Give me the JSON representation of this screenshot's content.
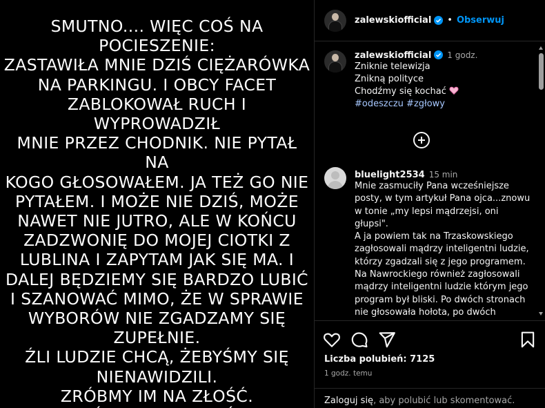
{
  "post_image": {
    "text": "SMUTNO....    WIĘC COŚ NA\nPOCIESZENIE:\nZASTAWIŁA MNIE DZIŚ CIĘŻARÓWKA\nNA PARKINGU. I OBCY FACET\nZABLOKOWAŁ RUCH I WYPROWADZIŁ\nMNIE PRZEZ CHODNIK. NIE PYTAŁ NA\nKOGO GŁOSOWAŁEM. JA TEŻ GO NIE\nPYTAŁEM. I MOŻE NIE DZIŚ, MOŻE\nNAWET NIE JUTRO, ALE W KOŃCU\nZADZWONIĘ DO MOJEJ CIOTKI Z\nLUBLINA I ZAPYTAM JAK SIĘ MA. I\nDALEJ BĘDZIEMY SIĘ BARDZO LUBIĆ\nI SZANOWAĆ MIMO, ŻE W SPRAWIE\nWYBORÓW NIE ZGADZAMY SIĘ\nZUPEŁNIE.\nŹLI LUDZIE CHCĄ, ŻEBYŚMY SIĘ\nNIENAWIDZILI.\nZRÓBMY IM NA ZŁOŚĆ.\nCHODŹMY SIĘ KOCHAĆ!!!"
  },
  "header": {
    "username": "zalewskiofficial",
    "separator": "•",
    "follow_label": "Obserwuj"
  },
  "caption": {
    "username": "zalewskiofficial",
    "time": "1 godz.",
    "text": "Zniknie telewizja\nZnikną polityce\nChodźmy się kochać",
    "hashtags": [
      "#odeszczu",
      "#zgłowy"
    ]
  },
  "comment": {
    "username": "bluelight2534",
    "time": "15 min",
    "text": "Mnie zasmuciły Pana wcześniejsze\nposty, w tym artykuł Pana ojca...znowu\nw tonie „my lepsi mądrzejsi, oni głupsi\".\nA ja powiem tak na Trzaskowskiego\nzagłosowali mądrzy inteligentni ludzie,\nktórzy zgadzali się z jego programem.\nNa Nawrockiego również zagłosowali\nmądrzy inteligentni ludzie którym jego\nprogram był bliski. Po dwóch stronach\nnie głosowała hołota, po dwóch\nstronach głosowali ludzie... nic mnie tak"
  },
  "actions": {
    "likes": "Liczba polubień: 7125",
    "posted_time": "1 godz. temu",
    "login_link": "Zaloguj się",
    "login_rest": ", aby polubić lub skomentować."
  },
  "icons": [
    "heart-icon",
    "comment-icon",
    "share-icon",
    "bookmark-icon",
    "verified-icon",
    "plus-circle-icon",
    "heart-emoji-icon"
  ],
  "colors": {
    "accent": "#0095f6",
    "verified": "#0095f6",
    "hashtag": "#a7c8ff",
    "secondary_text": "#a8a8a8",
    "border": "#262626"
  }
}
